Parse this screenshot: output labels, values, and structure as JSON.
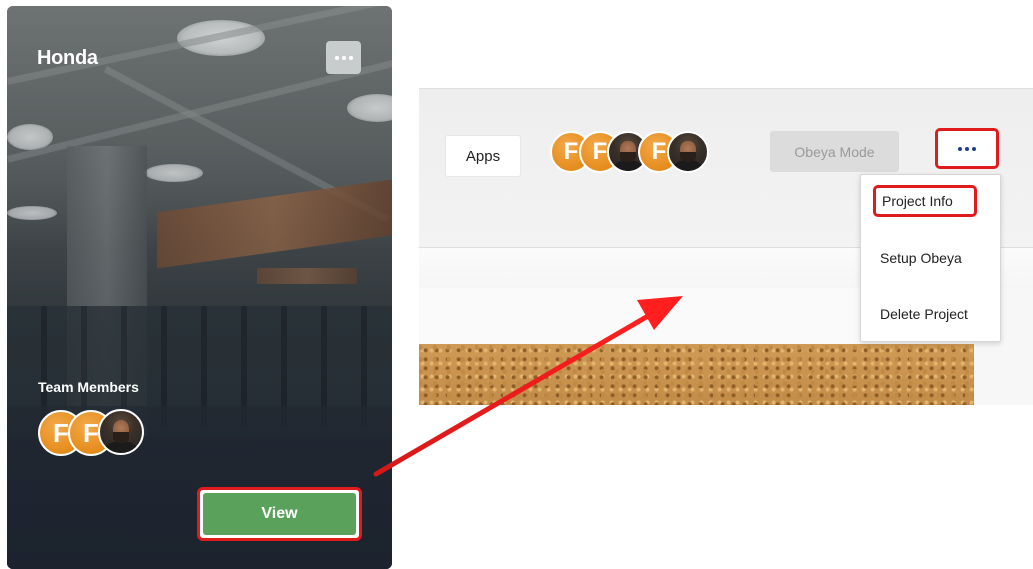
{
  "card": {
    "title": "Honda",
    "team_label": "Team Members",
    "avatars": [
      {
        "type": "letter",
        "letter": "F"
      },
      {
        "type": "letter",
        "letter": "F"
      },
      {
        "type": "photo"
      }
    ],
    "view_label": "View"
  },
  "panel": {
    "apps_label": "Apps",
    "avatars": [
      {
        "type": "letter",
        "letter": "F"
      },
      {
        "type": "letter",
        "letter": "F"
      },
      {
        "type": "photo"
      },
      {
        "type": "letter",
        "letter": "F"
      },
      {
        "type": "photo"
      }
    ],
    "obeya_mode_label": "Obeya Mode",
    "menu_items": [
      {
        "label": "Project Info",
        "highlighted": true
      },
      {
        "label": "Setup Obeya",
        "highlighted": false
      },
      {
        "label": "Delete Project",
        "highlighted": false
      }
    ]
  },
  "colors": {
    "highlight": "#e11b1b",
    "view_button": "#5aa25c",
    "avatar_orange": "#e58c1c",
    "dots_blue": "#1d3f8f"
  },
  "icons": {
    "card_menu": "ellipsis-icon",
    "panel_menu": "ellipsis-icon",
    "annotation": "arrow-icon"
  }
}
